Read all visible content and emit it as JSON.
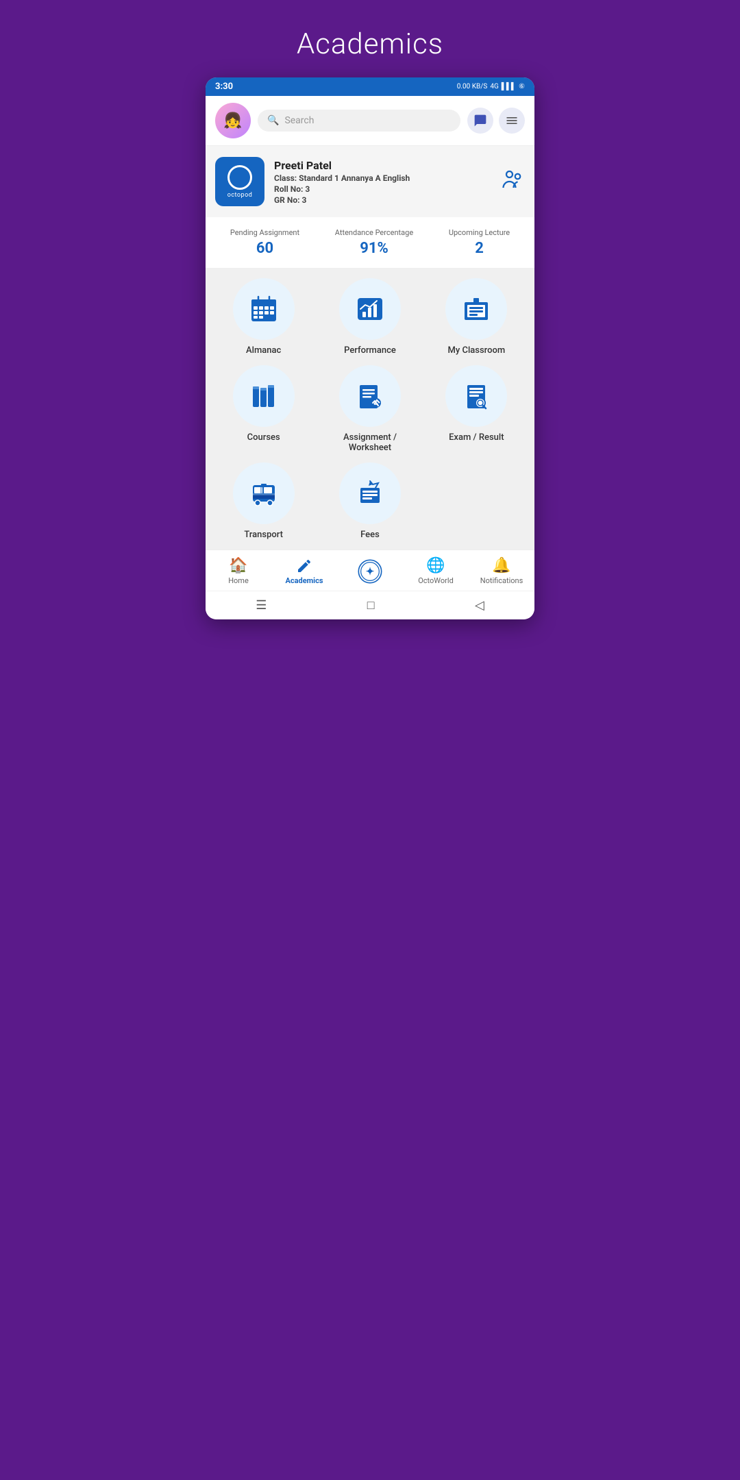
{
  "page": {
    "title": "Academics"
  },
  "statusBar": {
    "time": "3:30",
    "network": "0.00 KB/S",
    "network2": "4G"
  },
  "search": {
    "placeholder": "Search"
  },
  "profile": {
    "name": "Preeti Patel",
    "class_label": "Class:",
    "class_value": "Standard 1 Annanya A English",
    "roll_label": "Roll No:",
    "roll_value": "3",
    "gr_label": "GR No:",
    "gr_value": "3"
  },
  "stats": [
    {
      "label": "Pending Assignment",
      "value": "60"
    },
    {
      "label": "Attendance Percentage",
      "value": "91%"
    },
    {
      "label": "Upcoming Lecture",
      "value": "2"
    }
  ],
  "grid": [
    {
      "id": "almanac",
      "label": "Almanac",
      "icon": "calendar"
    },
    {
      "id": "performance",
      "label": "Performance",
      "icon": "chart"
    },
    {
      "id": "my-classroom",
      "label": "My Classroom",
      "icon": "classroom"
    },
    {
      "id": "courses",
      "label": "Courses",
      "icon": "books"
    },
    {
      "id": "assignment",
      "label": "Assignment /\nWorksheet",
      "icon": "assignment"
    },
    {
      "id": "exam",
      "label": "Exam / Result",
      "icon": "exam"
    },
    {
      "id": "transport",
      "label": "Transport",
      "icon": "bus"
    },
    {
      "id": "fees",
      "label": "Fees",
      "icon": "fees"
    }
  ],
  "bottomNav": [
    {
      "id": "home",
      "label": "Home",
      "icon": "🏠",
      "active": false
    },
    {
      "id": "academics",
      "label": "Academics",
      "icon": "✏️",
      "active": true
    },
    {
      "id": "octoworld-center",
      "label": "",
      "icon": "⊕",
      "active": false
    },
    {
      "id": "octoworld",
      "label": "OctoWorld",
      "icon": "🌐",
      "active": false
    },
    {
      "id": "notifications",
      "label": "Notifications",
      "icon": "🔔",
      "active": false
    }
  ]
}
